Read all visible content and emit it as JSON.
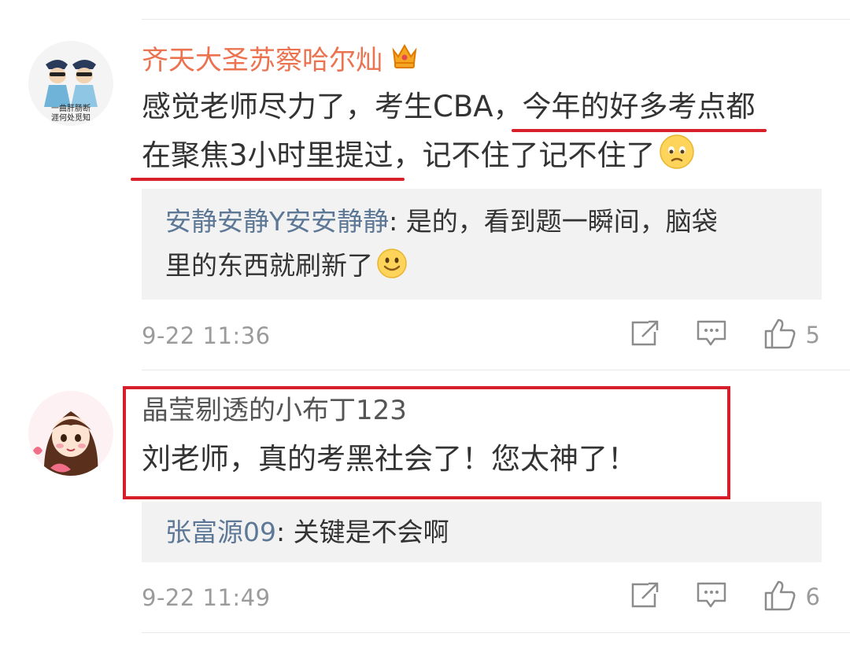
{
  "comments": [
    {
      "username": "齐天大圣苏察哈尔灿",
      "text_pre": "感觉老师尽力了，考生CBA，",
      "text_hl1": "今年的好多考点都",
      "text_hl2": "在聚焦3小时里提过",
      "text_post": "，记不住了记不住了",
      "avatar_caption_1": "一曲肝肠断",
      "avatar_caption_2": "涯何处觅知",
      "reply": {
        "user": "安静安静Y安安静静",
        "sep": ": ",
        "text_line1": "是的，看到题一瞬间，脑袋",
        "text_line2": "里的东西就刷新了"
      },
      "time": "9-22 11:36",
      "likes": "5"
    },
    {
      "username": "晶莹剔透的小布丁123",
      "text": "刘老师，真的考黑社会了！您太神了！",
      "reply": {
        "user": "张富源09",
        "sep": ": ",
        "text": "关键是不会啊"
      },
      "time": "9-22 11:49",
      "likes": "6"
    }
  ],
  "icons": {
    "share": "share-icon",
    "comment": "comment-icon",
    "like": "thumbs-up-icon",
    "vip": "crown-vip-icon",
    "emoji_sad": "sad-face-emoji-icon",
    "emoji_smile": "smile-emoji-icon"
  },
  "colors": {
    "username_orange": "#eb7350",
    "reply_blue": "#5d7896",
    "highlight_red": "#d8202b",
    "meta_gray": "#9b9b9b"
  }
}
